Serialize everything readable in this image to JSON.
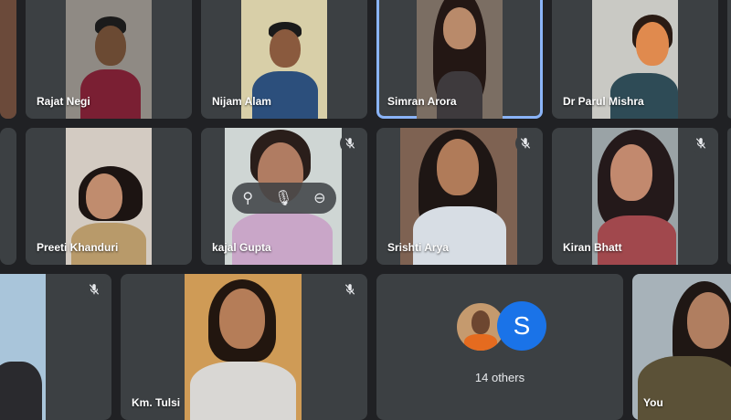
{
  "participants": [
    {
      "name": "Rajat Negi"
    },
    {
      "name": "Nijam Alam"
    },
    {
      "name": "Simran Arora"
    },
    {
      "name": "Dr Parul Mishra"
    },
    {
      "name": "Preeti Khanduri"
    },
    {
      "name": "kajal Gupta"
    },
    {
      "name": "Srishti Arya"
    },
    {
      "name": "Kiran Bhatt"
    },
    {
      "name": "Km. Tulsi"
    },
    {
      "name": "You"
    }
  ],
  "others": {
    "label": "14 others",
    "avatar_letter": "S"
  },
  "colors": {
    "background": "#202124",
    "tile": "#3c4043",
    "active_border": "#8ab4f8",
    "avatar_blue": "#1a73e8"
  },
  "icons": {
    "muted": "mic-off-icon",
    "pin": "pin-icon",
    "remove": "remove-icon"
  }
}
